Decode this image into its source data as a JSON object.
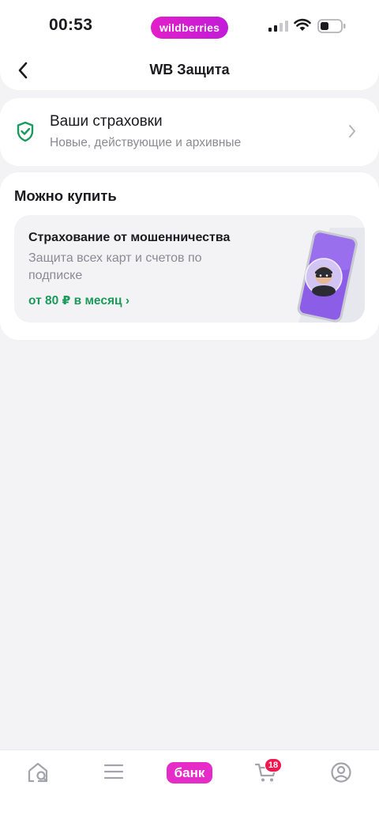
{
  "status_bar": {
    "time": "00:53",
    "brand": "wildberries"
  },
  "header": {
    "title": "WB Защита"
  },
  "my_insurance": {
    "title": "Ваши страховки",
    "subtitle": "Новые, действующие и архивные"
  },
  "buy_section": {
    "title": "Можно купить",
    "offer": {
      "title": "Страхование от мошенничества",
      "description": "Защита всех карт и счетов по подписке",
      "price": "от 80 ₽ в месяц ›"
    }
  },
  "tabbar": {
    "bank_label": "банк",
    "cart_badge": "18"
  },
  "colors": {
    "accent_pink": "#e62cc8",
    "accent_green": "#1a9a5b",
    "badge_red": "#f0184f"
  }
}
